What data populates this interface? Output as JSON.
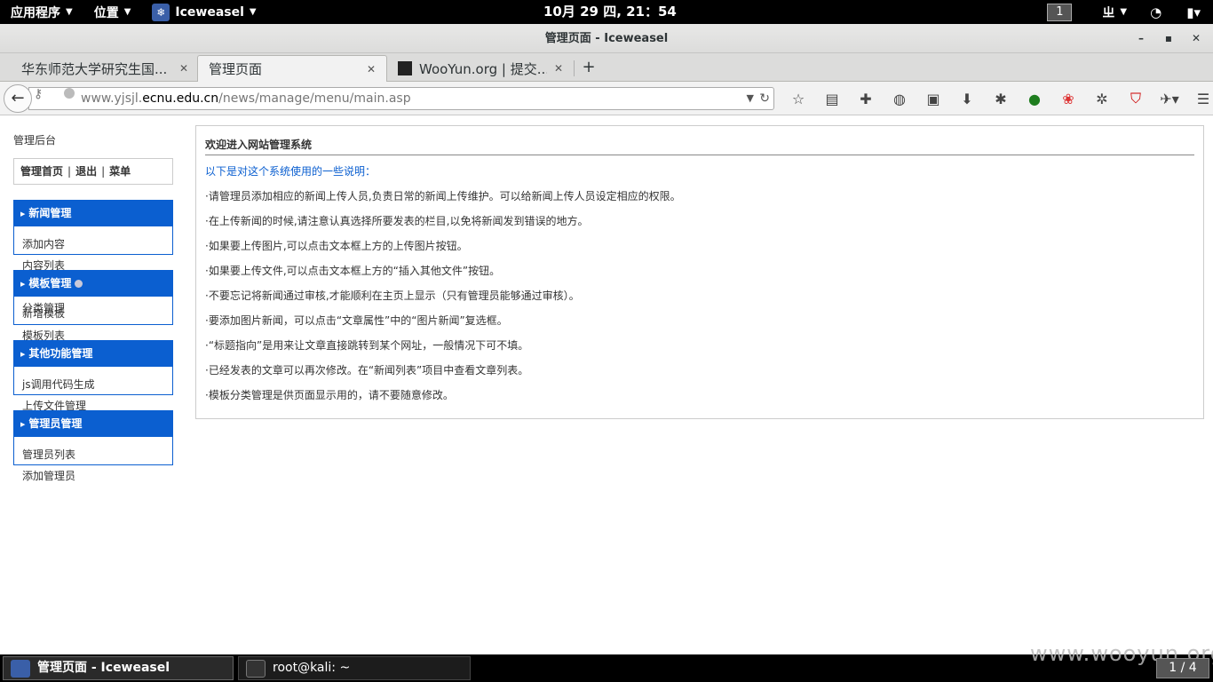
{
  "top_panel": {
    "applications": "应用程序",
    "places": "位置",
    "active_app": "Iceweasel",
    "clock": "10月 29 四, 21：54",
    "workspace": "1",
    "input_method": "ㄓ",
    "icons": [
      "wifi-icon",
      "power-icon"
    ]
  },
  "window": {
    "title": "管理页面 - Iceweasel",
    "minimize": "–",
    "maximize": "▪",
    "close": "✕"
  },
  "tabs": [
    {
      "title": "华东师范大学研究生国...",
      "close": "✕"
    },
    {
      "title": "管理页面",
      "close": "✕"
    },
    {
      "title": "WooYun.org | 提交...",
      "close": "✕"
    }
  ],
  "new_tab": "+",
  "url": {
    "prefix": "www.yjsjl.",
    "host": "ecnu.edu.cn",
    "path": "/news/manage/menu/main.asp"
  },
  "toolbar_icons": [
    "bookmark-star-icon",
    "reading-list-icon",
    "addons-icon",
    "compass-icon",
    "reader-icon",
    "download-icon",
    "settings-gear-icon",
    "green-extension-icon",
    "red-extension-icon",
    "gear-extension-icon",
    "shield-icon",
    "bug-icon",
    "menu-icon"
  ],
  "sidebar": {
    "title": "管理后台",
    "links": {
      "home": "管理首页",
      "logout": "退出",
      "menu": "菜单",
      "sep": "|"
    },
    "sections": [
      {
        "header": "新闻管理",
        "items": [
          "添加内容",
          "内容列表"
        ]
      },
      {
        "header": "模板管理",
        "items": [
          "新增模板",
          "分类管理",
          "模板列表"
        ]
      },
      {
        "header": "其他功能管理",
        "items": [
          "js调用代码生成",
          "上传文件管理"
        ]
      },
      {
        "header": "管理员管理",
        "items": [
          "管理员列表",
          "添加管理员"
        ]
      }
    ]
  },
  "main": {
    "title": "欢迎进入网站管理系统",
    "subtitle": "以下是对这个系统使用的一些说明：",
    "notes": [
      "·请管理员添加相应的新闻上传人员,负责日常的新闻上传维护。可以给新闻上传人员设定相应的权限。",
      "·在上传新闻的时候,请注意认真选择所要发表的栏目,以免将新闻发到错误的地方。",
      "·如果要上传图片,可以点击文本框上方的上传图片按钮。",
      "·如果要上传文件,可以点击文本框上方的“插入其他文件”按钮。",
      "·不要忘记将新闻通过审核,才能顺利在主页上显示（只有管理员能够通过审核）。",
      "·要添加图片新闻，可以点击“文章属性”中的“图片新闻”复选框。",
      "·“标题指向”是用来让文章直接跳转到某个网址，一般情况下可不填。",
      "·已经发表的文章可以再次修改。在“新闻列表”项目中查看文章列表。",
      "·模板分类管理是供页面显示用的，请不要随意修改。"
    ]
  },
  "taskbar": {
    "items": [
      {
        "label": "管理页面 - Iceweasel"
      },
      {
        "label": "root@kali: ~"
      }
    ],
    "workspace": "1 / 4",
    "watermark": "www.wooyun.org"
  }
}
